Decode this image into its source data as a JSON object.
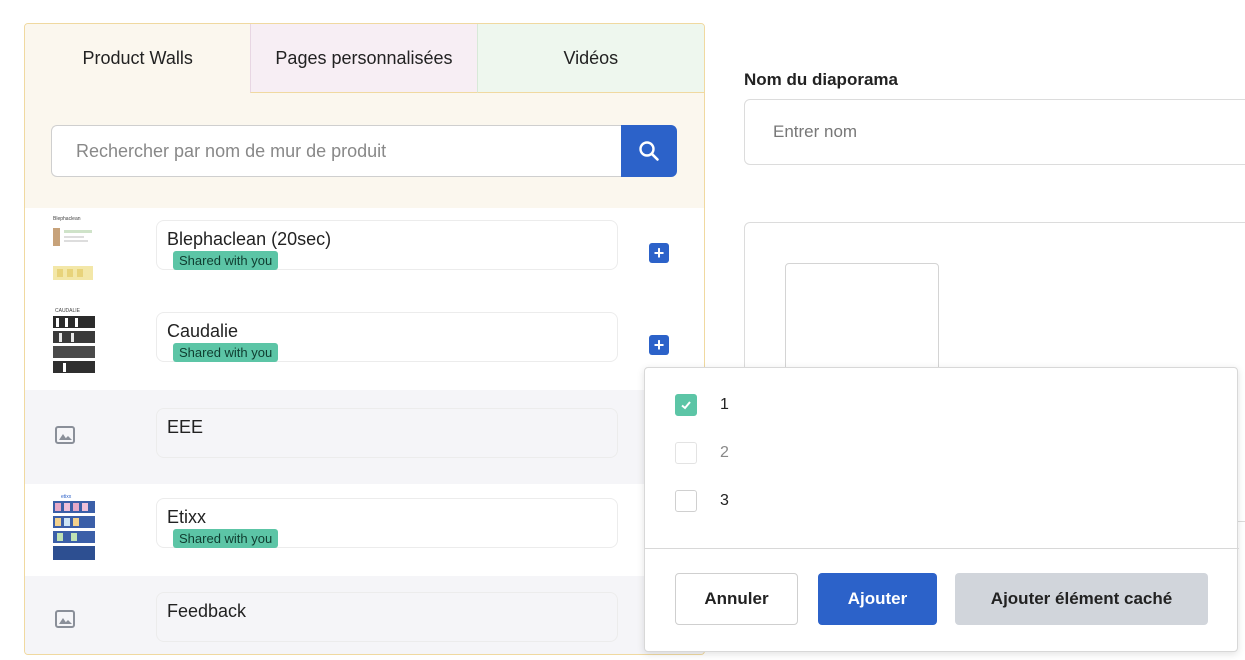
{
  "tabs": [
    {
      "label": "Product Walls"
    },
    {
      "label": "Pages personnalisées"
    },
    {
      "label": "Vidéos"
    }
  ],
  "search": {
    "placeholder": "Rechercher par nom de mur de produit"
  },
  "icons": {
    "search": "search-icon",
    "add": "plus-icon",
    "image": "image-placeholder-icon",
    "check": "check-icon"
  },
  "list": {
    "items": [
      {
        "name": "Blephaclean (20sec)",
        "badge": "Shared with you",
        "thumb": "blephaclean-thumbnail",
        "thumb_caption": "Blephaclean"
      },
      {
        "name": "Caudalie",
        "badge": "Shared with you",
        "thumb": "caudalie-thumbnail",
        "thumb_caption": "CAUDALIE"
      },
      {
        "name": "EEE",
        "badge": "",
        "thumb": "image-placeholder-icon"
      },
      {
        "name": "Etixx",
        "badge": "Shared with you",
        "thumb": "etixx-thumbnail",
        "thumb_caption": "etixx"
      },
      {
        "name": "Feedback",
        "badge": "",
        "thumb": "image-placeholder-icon"
      }
    ],
    "plus_symbol": "+"
  },
  "form": {
    "name_label": "Nom du diaporama",
    "name_placeholder": "Entrer nom"
  },
  "popover": {
    "options": [
      {
        "label": "1",
        "checked": true,
        "disabled": false
      },
      {
        "label": "2",
        "checked": false,
        "disabled": true
      },
      {
        "label": "3",
        "checked": false,
        "disabled": false
      }
    ],
    "cancel_label": "Annuler",
    "add_label": "Ajouter",
    "add_hidden_label": "Ajouter élément caché"
  },
  "colors": {
    "primary": "#2c62c9",
    "badge": "#5cc5a6",
    "secondary_button": "#d1d5db",
    "tab_product_walls": "#fbf7ee",
    "tab_pages": "#f7eef4",
    "tab_videos": "#eef7ee"
  }
}
